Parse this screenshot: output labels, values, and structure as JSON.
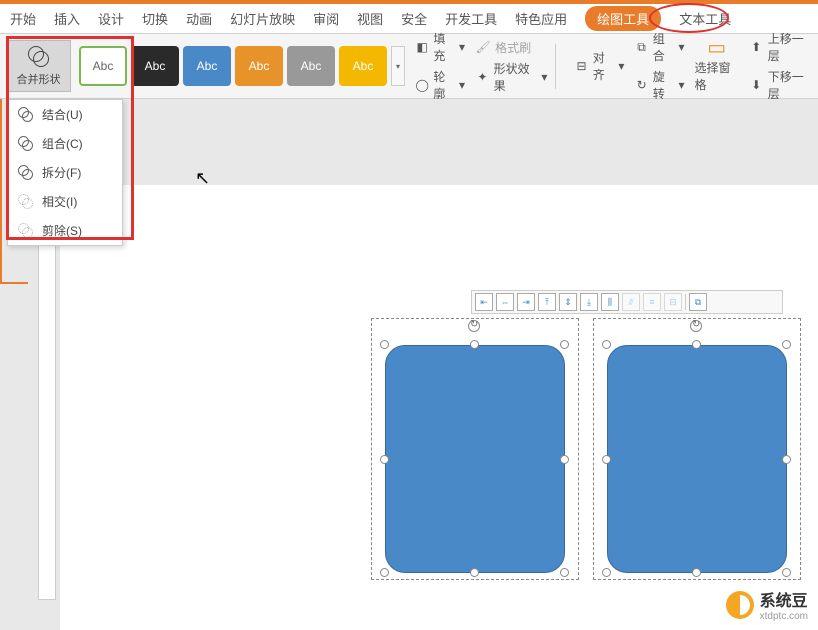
{
  "menu": {
    "items": [
      "开始",
      "插入",
      "设计",
      "切换",
      "动画",
      "幻灯片放映",
      "审阅",
      "视图",
      "安全",
      "开发工具",
      "特色应用",
      "绘图工具",
      "文本工具"
    ],
    "active_index": 11
  },
  "ribbon": {
    "merge_label": "合并形状",
    "style_swatch_text": "Abc",
    "fill_label": "填充",
    "outline_label": "轮廓",
    "format_painter": "格式刷",
    "shape_effects": "形状效果",
    "align_label": "对齐",
    "group_label": "组合",
    "rotate_label": "旋转",
    "selection_pane": "选择窗格",
    "move_up": "上移一层",
    "move_down": "下移一层"
  },
  "dropdown": {
    "items": [
      {
        "label": "结合(U)",
        "icon": "union"
      },
      {
        "label": "组合(C)",
        "icon": "combine"
      },
      {
        "label": "拆分(F)",
        "icon": "fragment"
      },
      {
        "label": "相交(I)",
        "icon": "intersect"
      },
      {
        "label": "剪除(S)",
        "icon": "subtract"
      }
    ]
  },
  "watermark": {
    "title": "系统豆",
    "url": "xtdptc.com"
  }
}
